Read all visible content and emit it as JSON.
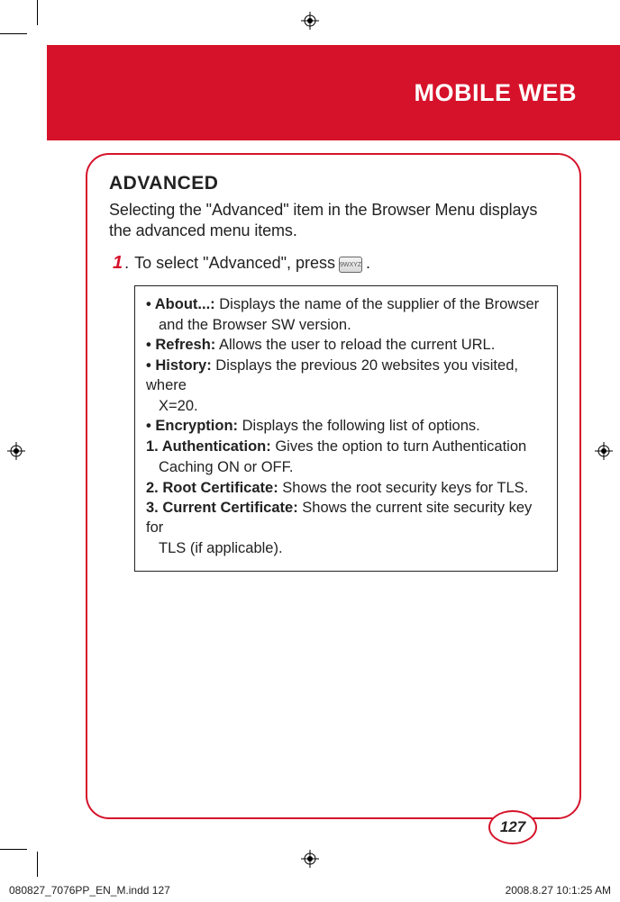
{
  "banner": {
    "title": "MOBILE WEB"
  },
  "section": {
    "heading": "ADVANCED",
    "intro": "Selecting the \"Advanced\" item in the Browser Menu displays the advanced menu items.",
    "step": {
      "num": "1",
      "dot": ".",
      "before": "To select \"Advanced\", press",
      "key_label": "9WXYZ",
      "after": "."
    }
  },
  "options": {
    "about_lead": "• About...:",
    "about_text": " Displays the name of the supplier of the Browser",
    "about_cont": "and the Browser SW version.",
    "refresh_lead": "• Refresh:",
    "refresh_text": " Allows the user to reload the current URL.",
    "history_lead": "• History:",
    "history_text": " Displays the previous 20 websites you visited, where",
    "history_cont": "X=20.",
    "encryption_lead": "• Encryption:",
    "encryption_text": " Displays the following list of options.",
    "auth_lead": "1. Authentication:",
    "auth_text": " Gives the option to turn Authentication",
    "auth_cont": "Caching ON or OFF.",
    "root_lead": "2. Root Certificate:",
    "root_text": " Shows the root security keys for TLS.",
    "curr_lead": "3. Current Certificate:",
    "curr_text": " Shows the current site security key for",
    "curr_cont": "TLS (if applicable)."
  },
  "page_number": "127",
  "footer": {
    "left": "080827_7076PP_EN_M.indd   127",
    "right": "2008.8.27   10:1:25 AM"
  }
}
